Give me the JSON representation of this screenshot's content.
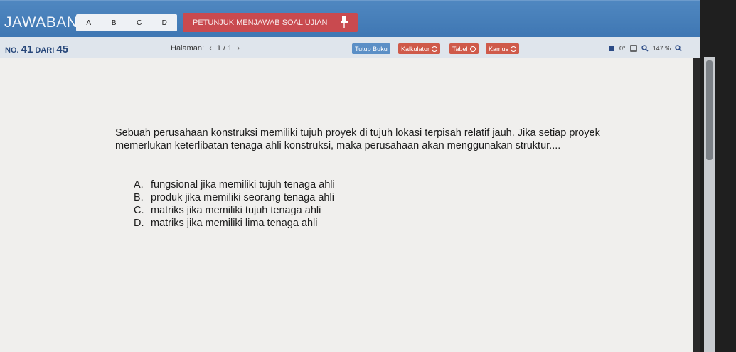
{
  "header": {
    "jawaban_label": "JAWABAN:",
    "options": [
      "A",
      "B",
      "C",
      "D"
    ],
    "petunjuk_label": "PETUNJUK MENJAWAB SOAL UJIAN"
  },
  "subbar": {
    "no_prefix": "NO.",
    "no_current": "41",
    "dari": "DARI",
    "no_total": "45",
    "halaman_label": "Halaman:",
    "prev": "‹",
    "page": "1 / 1",
    "next": "›",
    "buttons": [
      "Tutup Buku",
      "Kalkulator",
      "Tabel",
      "Kamus"
    ],
    "rotate_label": "0°",
    "zoom": "147 %"
  },
  "question": {
    "text": "Sebuah perusahaan konstruksi memiliki tujuh proyek di tujuh lokasi terpisah relatif jauh. Jika setiap proyek memerlukan keterlibatan tenaga ahli konstruksi, maka perusahaan akan menggunakan struktur....",
    "choices": [
      {
        "letter": "A.",
        "text": "fungsional jika memiliki tujuh tenaga ahli"
      },
      {
        "letter": "B.",
        "text": "produk jika memiliki seorang tenaga ahli"
      },
      {
        "letter": "C.",
        "text": "matriks jika memiliki tujuh tenaga ahli"
      },
      {
        "letter": "D.",
        "text": "matriks jika memiliki lima tenaga ahli"
      }
    ]
  }
}
